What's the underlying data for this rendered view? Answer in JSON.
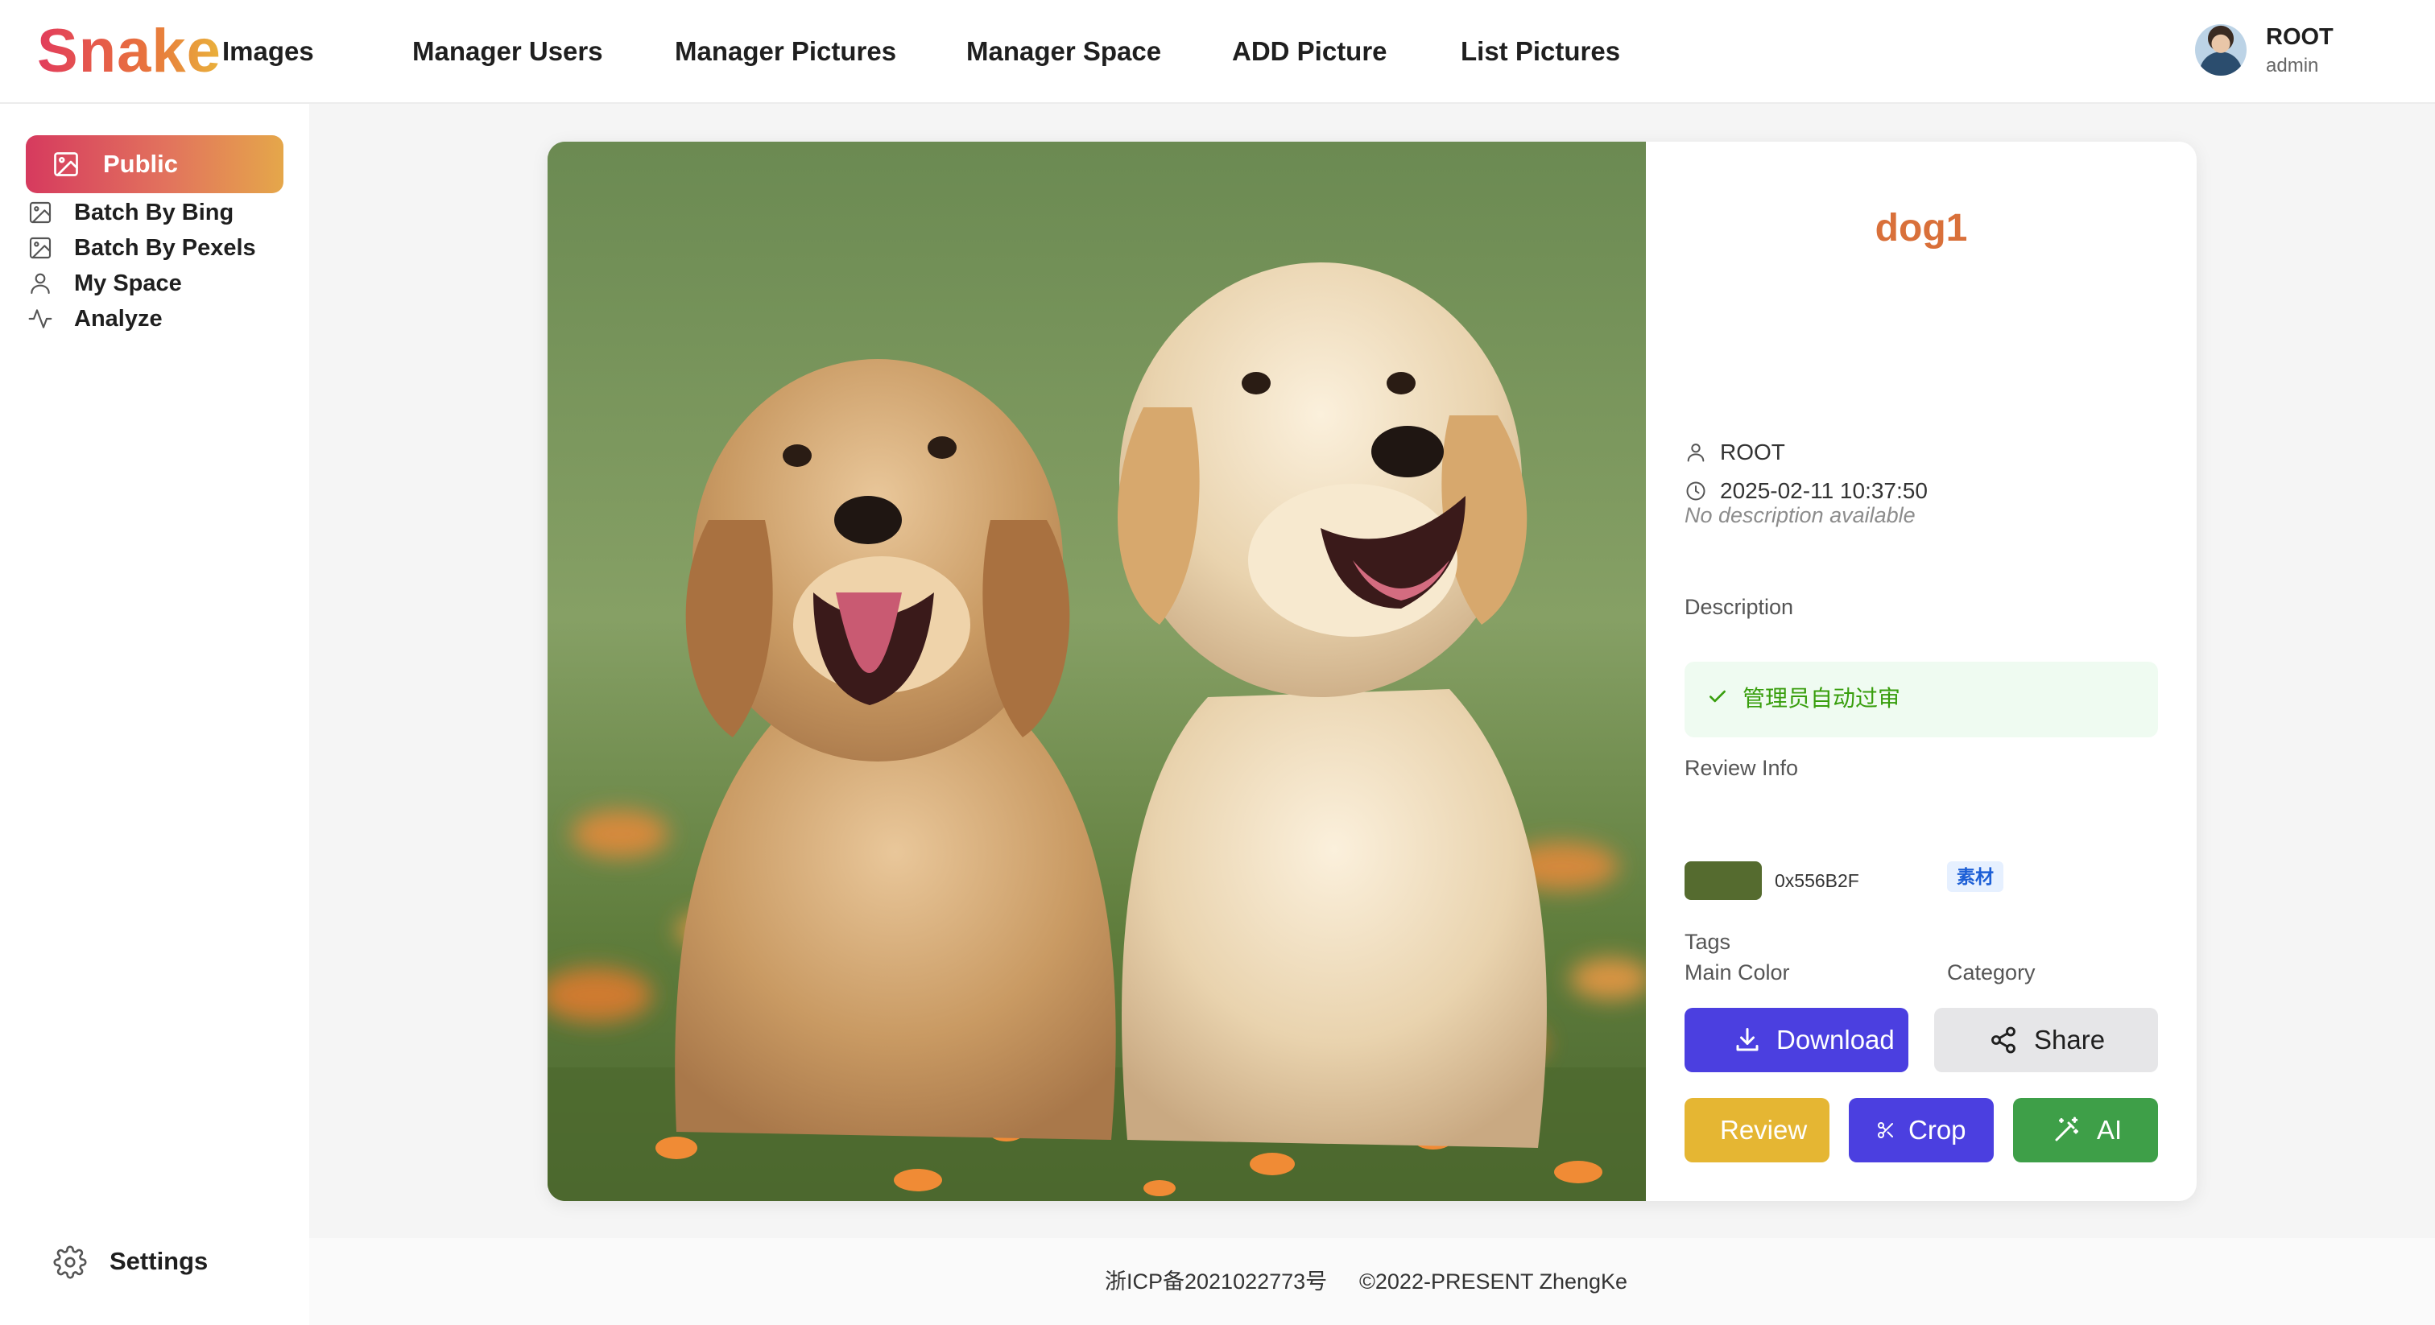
{
  "header": {
    "logo": "Snake",
    "logo_sub": "Images",
    "nav": [
      {
        "label": "Manager Users"
      },
      {
        "label": "Manager Pictures"
      },
      {
        "label": "Manager Space"
      },
      {
        "label": "ADD Picture"
      },
      {
        "label": "List Pictures"
      }
    ],
    "user": {
      "name": "ROOT",
      "role": "admin"
    }
  },
  "sidebar": {
    "items": [
      {
        "label": "Public",
        "icon": "image-icon",
        "active": true
      },
      {
        "label": "Batch By Bing",
        "icon": "image-icon"
      },
      {
        "label": "Batch By Pexels",
        "icon": "image-icon"
      },
      {
        "label": "My Space",
        "icon": "user-icon"
      },
      {
        "label": "Analyze",
        "icon": "activity-icon"
      }
    ],
    "settings_label": "Settings"
  },
  "picture": {
    "title": "dog1",
    "author": "ROOT",
    "created": "2025-02-11 10:37:50",
    "description_label": "Description",
    "description": "No description available",
    "review_label": "Review Info",
    "review_message": "管理员自动过审",
    "main_color_label": "Main Color",
    "main_color_hex": "0x556B2F",
    "main_color": "#556B2F",
    "category_label": "Category",
    "category": "素材",
    "tags_label": "Tags"
  },
  "actions": {
    "download": "Download",
    "share": "Share",
    "review": "Review",
    "crop": "Crop",
    "ai": "AI"
  },
  "footer": {
    "icp": "浙ICP备2021022773号",
    "copyright": "©2022-PRESENT ZhengKe"
  },
  "colors": {
    "accent": "#4b3fe0",
    "title": "#d9703a",
    "review_bg": "#effbf1",
    "review_text": "#389e0d"
  }
}
